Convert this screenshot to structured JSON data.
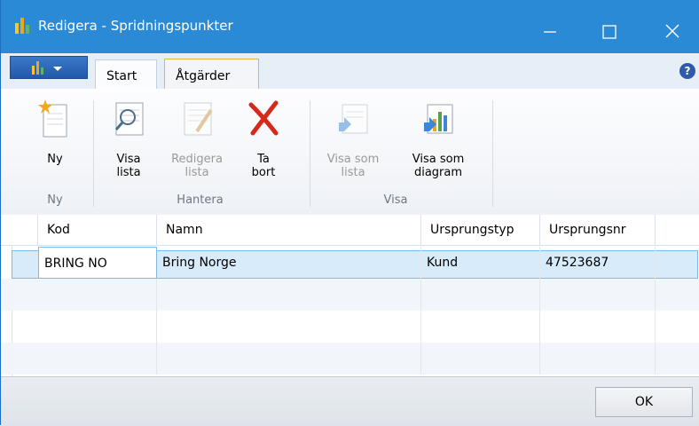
{
  "window": {
    "title": "Redigera - Spridningspunkter",
    "controls": {
      "minimize": "—",
      "maximize": "☐",
      "close": "✕"
    }
  },
  "ribbon": {
    "tabs": [
      {
        "label": "Start",
        "active": true
      },
      {
        "label": "Åtgärder",
        "active": false
      }
    ],
    "help_label": "?",
    "groups": [
      {
        "label": "Ny",
        "buttons": [
          {
            "label": "Ny",
            "icon": "new-document-icon",
            "enabled": true
          }
        ]
      },
      {
        "label": "Hantera",
        "buttons": [
          {
            "label": "Visa lista",
            "icon": "view-list-icon",
            "enabled": true
          },
          {
            "label": "Redigera lista",
            "icon": "edit-list-icon",
            "enabled": false
          },
          {
            "label": "Ta bort",
            "icon": "delete-icon",
            "enabled": true
          }
        ]
      },
      {
        "label": "Visa",
        "buttons": [
          {
            "label": "Visa som lista",
            "icon": "show-as-list-icon",
            "enabled": false
          },
          {
            "label": "Visa som diagram",
            "icon": "show-as-chart-icon",
            "enabled": true
          }
        ]
      }
    ]
  },
  "grid": {
    "columns": [
      "Kod",
      "Namn",
      "Ursprungstyp",
      "Ursprungsnr"
    ],
    "rows": [
      [
        "BRING NO",
        "Bring Norge",
        "Kund",
        "47523687"
      ]
    ]
  },
  "footer": {
    "ok_label": "OK"
  },
  "colors": {
    "titlebar": "#2b8ad6",
    "selection": "#d8ebfb",
    "delete": "#d42a1c"
  }
}
